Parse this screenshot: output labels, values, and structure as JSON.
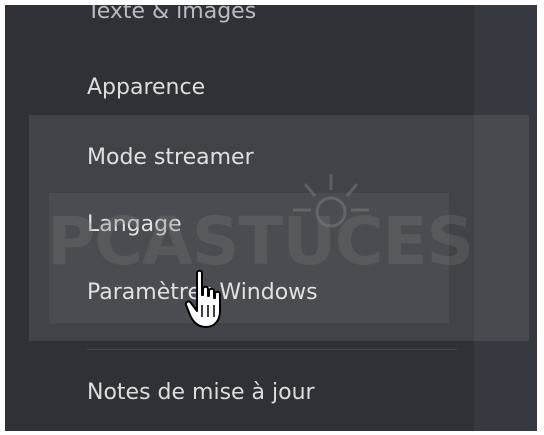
{
  "menu": {
    "items": [
      {
        "label": "Texte & images"
      },
      {
        "label": "Apparence"
      },
      {
        "label": "Mode streamer"
      },
      {
        "label": "Langage"
      },
      {
        "label": "Paramètres Windows"
      },
      {
        "label": "Notes de mise à jour"
      }
    ]
  },
  "watermark": {
    "text": "PCASTUCES"
  },
  "colors": {
    "sidebar_bg": "#2f3136",
    "panel_bg": "#36393f",
    "text": "#dcddde"
  }
}
